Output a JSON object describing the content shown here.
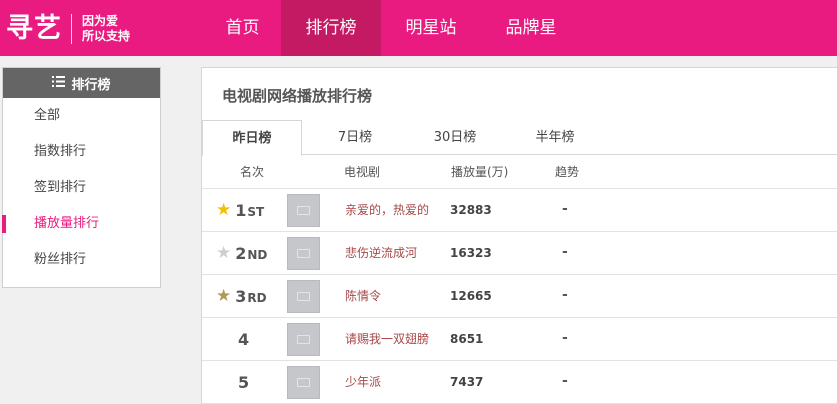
{
  "logo": {
    "text": "寻艺",
    "slogan_line1": "因为爱",
    "slogan_line2": "所以支持"
  },
  "nav": [
    "首页",
    "排行榜",
    "明星站",
    "品牌星"
  ],
  "sidebar": {
    "title": "排行榜",
    "items": [
      {
        "label": "全部"
      },
      {
        "label": "指数排行"
      },
      {
        "label": "签到排行"
      },
      {
        "label": "播放量排行",
        "active": true
      },
      {
        "label": "粉丝排行"
      }
    ]
  },
  "panel": {
    "title": "电视剧网络播放排行榜",
    "tabs": [
      "昨日榜",
      "7日榜",
      "30日榜",
      "半年榜"
    ],
    "columns": {
      "rank": "名次",
      "drama": "电视剧",
      "plays": "播放量(万)",
      "trend": "趋势"
    },
    "rows": [
      {
        "rank": "1",
        "suffix": "ST",
        "star": "gold",
        "drama": "亲爱的，热爱的",
        "plays": "32883",
        "trend": "-"
      },
      {
        "rank": "2",
        "suffix": "ND",
        "star": "silver",
        "drama": "悲伤逆流成河",
        "plays": "16323",
        "trend": "-"
      },
      {
        "rank": "3",
        "suffix": "RD",
        "star": "bronze",
        "drama": "陈情令",
        "plays": "12665",
        "trend": "-"
      },
      {
        "rank": "4",
        "suffix": "",
        "star": "",
        "drama": "请赐我一双翅膀",
        "plays": "8651",
        "trend": "-"
      },
      {
        "rank": "5",
        "suffix": "",
        "star": "",
        "drama": "少年派",
        "plays": "7437",
        "trend": "-"
      }
    ]
  },
  "colors": {
    "brand": "#ea1b80",
    "nav_active": "#c41a63",
    "gold": "#f2c200",
    "silver": "#cfcfcf",
    "bronze": "#b19a55",
    "drama_link": "#a64848"
  },
  "icons": {
    "menu": "list-icon",
    "star": "star-icon",
    "thumb": "tv-placeholder-icon"
  }
}
